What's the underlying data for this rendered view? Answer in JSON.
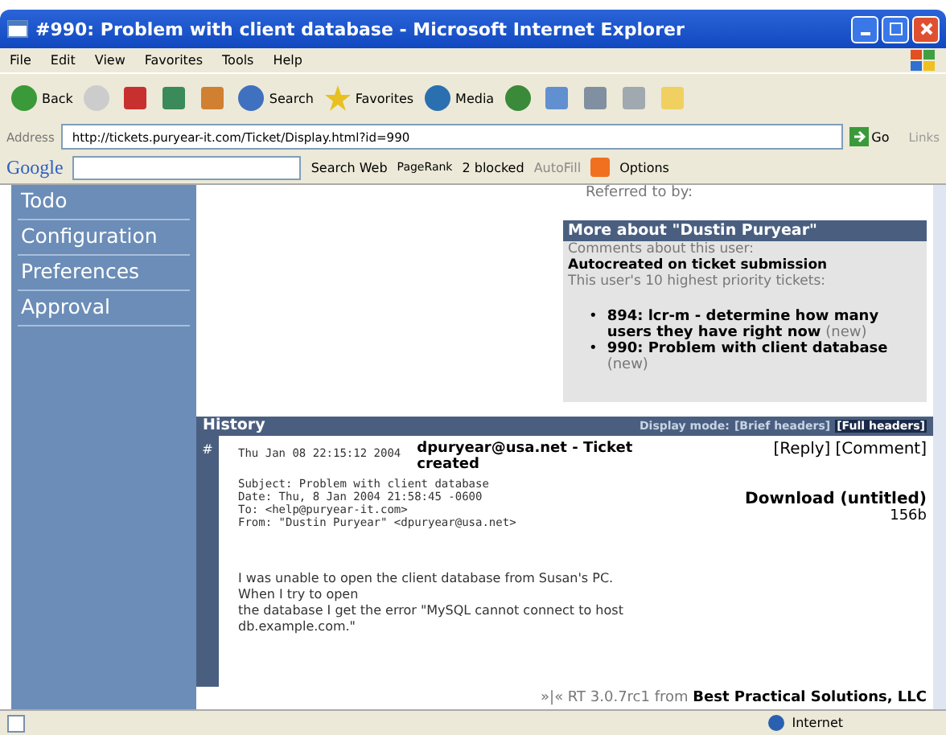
{
  "window": {
    "title": "#990: Problem with client database - Microsoft Internet Explorer"
  },
  "menu": [
    "File",
    "Edit",
    "View",
    "Favorites",
    "Tools",
    "Help"
  ],
  "toolbar": [
    {
      "kind": "back",
      "label": "Back",
      "disabled": false
    },
    {
      "kind": "forward",
      "disabled": true
    },
    {
      "kind": "stop",
      "disabled": false
    },
    {
      "kind": "refresh",
      "disabled": false
    },
    {
      "kind": "home",
      "disabled": false
    },
    {
      "kind": "search",
      "label": "Search",
      "disabled": false
    },
    {
      "kind": "favorites",
      "label": "Favorites",
      "disabled": false
    },
    {
      "kind": "media",
      "label": "Media",
      "disabled": false
    },
    {
      "kind": "history",
      "disabled": false
    },
    {
      "kind": "mail",
      "disabled": false
    },
    {
      "kind": "print",
      "disabled": false
    },
    {
      "kind": "edit",
      "disabled": false
    },
    {
      "kind": "folder",
      "disabled": false
    }
  ],
  "address": {
    "label": "Address",
    "value": "http://tickets.puryear-it.com/Ticket/Display.html?id=990",
    "go": "Go",
    "links": "Links"
  },
  "google_bar": {
    "logo": "Google",
    "search_web": "Search Web",
    "pagerank": "PageRank",
    "blocked": "2 blocked",
    "autofill": "AutoFill",
    "options": "Options"
  },
  "sidebar": {
    "items": [
      {
        "label": "Todo"
      },
      {
        "label": "Configuration"
      },
      {
        "label": "Preferences"
      },
      {
        "label": "Approval"
      }
    ]
  },
  "referred": "Referred to by:",
  "more_about": {
    "title": "More about \"Dustin Puryear\"",
    "comments_label": "Comments about this user:",
    "comment": "Autocreated on ticket submission",
    "tickets_label": "This user's 10 highest priority tickets:",
    "tickets": [
      {
        "bullet": "•",
        "title": "894: lcr-m - determine how many users they have right now",
        "status": "(new)"
      },
      {
        "bullet": "•",
        "title": "990: Problem with client database",
        "status": "(new)"
      }
    ]
  },
  "history": {
    "title": "History",
    "display_mode": "Display mode:",
    "modes": [
      {
        "label": "[Brief headers]",
        "selected": false
      },
      {
        "label": "[Full headers]",
        "selected": true
      }
    ],
    "entry": {
      "marker": "#",
      "date": "Thu Jan 08 22:15:12 2004",
      "description": "dpuryear@usa.net - Ticket created",
      "actions": [
        "[Reply]",
        "[Comment]"
      ],
      "headers": [
        "Subject: Problem with client database",
        "Date: Thu, 8 Jan 2004 21:58:45 -0600",
        "To: <help@puryear-it.com>",
        "From: \"Dustin Puryear\" <dpuryear@usa.net>"
      ],
      "download": "Download (untitled)",
      "size": "156b",
      "body": [
        "I was unable to open the client database from Susan's PC.",
        "When I try to open",
        "the database I get the error \"MySQL cannot connect to host",
        "db.example.com.\""
      ]
    }
  },
  "footer": {
    "prefix": "»|« RT 3.0.7rc1 from",
    "company": "Best Practical Solutions, LLC"
  },
  "status_bar": {
    "zone": "Internet"
  }
}
